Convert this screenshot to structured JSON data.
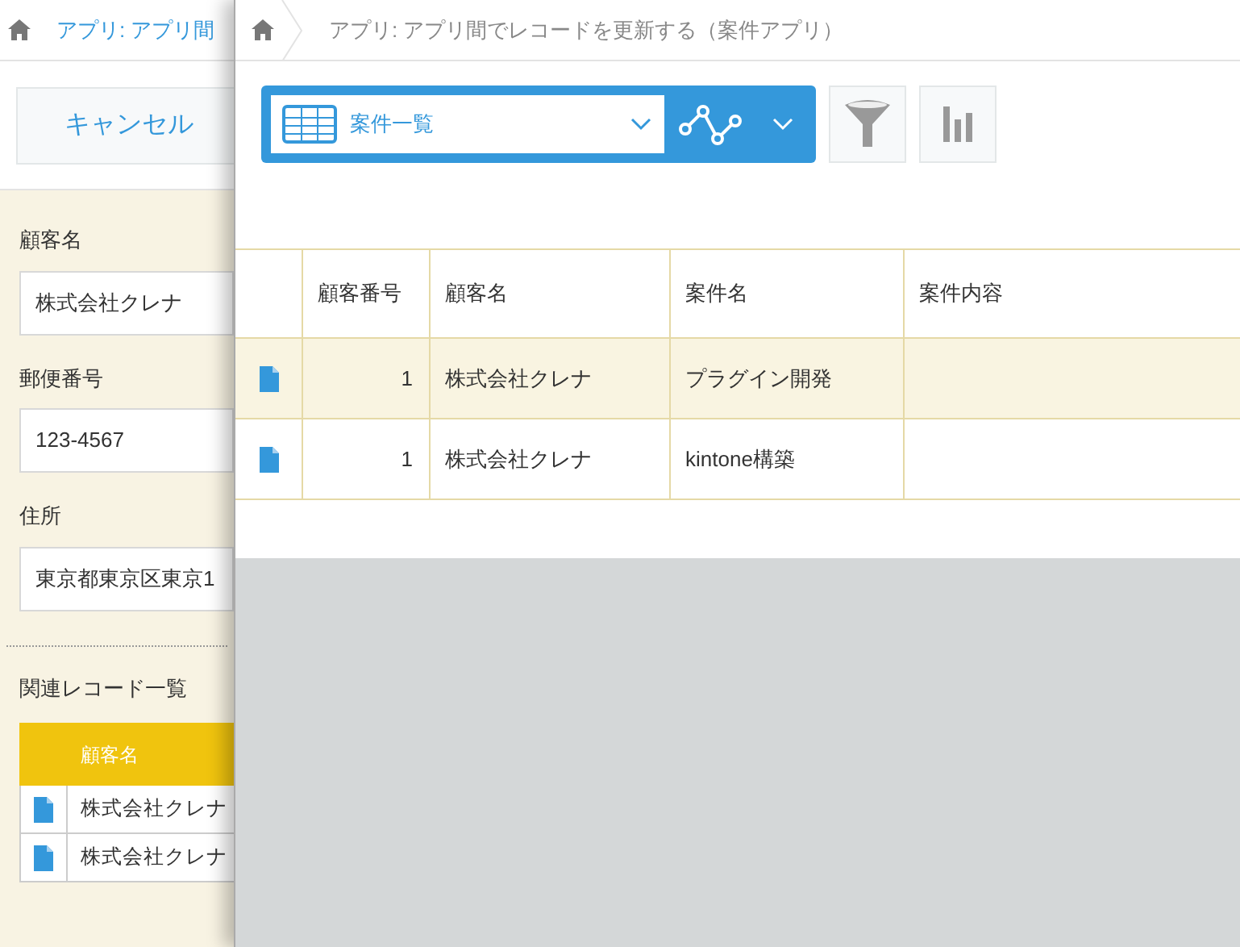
{
  "background_page": {
    "breadcrumb": "アプリ: アプリ間",
    "cancel_button": "キャンセル",
    "fields": [
      {
        "label": "顧客名",
        "value": "株式会社クレナ"
      },
      {
        "label": "郵便番号",
        "value": "123-4567"
      },
      {
        "label": "住所",
        "value": "東京都東京区東京1"
      }
    ],
    "related": {
      "title": "関連レコード一覧",
      "columns": [
        "顧客名"
      ],
      "rows": [
        {
          "cells": [
            "株式会社クレナ"
          ]
        },
        {
          "cells": [
            "株式会社クレナ"
          ]
        }
      ]
    }
  },
  "panel": {
    "breadcrumb": "アプリ: アプリ間でレコードを更新する（案件アプリ）",
    "view_select": {
      "value": "案件一覧"
    },
    "table": {
      "columns": [
        "顧客番号",
        "顧客名",
        "案件名",
        "案件内容"
      ],
      "rows": [
        {
          "selected": true,
          "cells": [
            "1",
            "株式会社クレナ",
            "プラグイン開発",
            ""
          ]
        },
        {
          "selected": false,
          "cells": [
            "1",
            "株式会社クレナ",
            "kintone構築",
            ""
          ]
        }
      ]
    }
  }
}
